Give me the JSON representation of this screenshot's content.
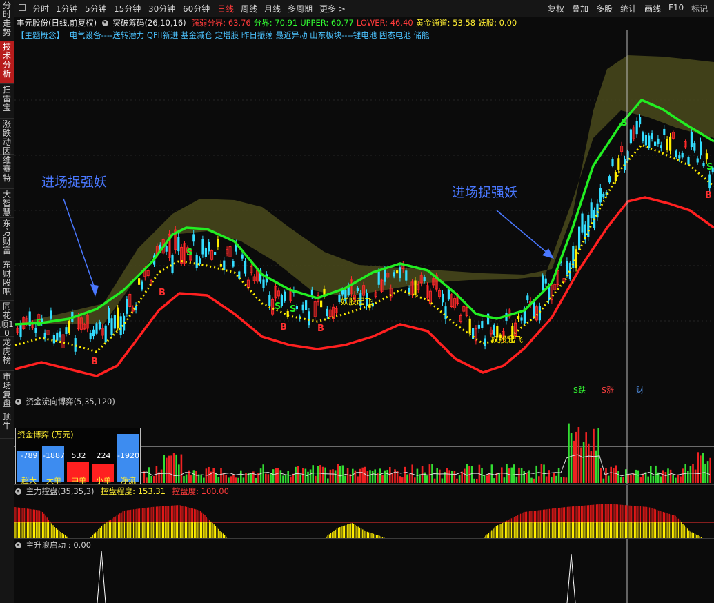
{
  "sidebar": {
    "items": [
      {
        "label": "分时走势"
      },
      {
        "label": "技术分析",
        "active": true
      },
      {
        "label": "扫雷宝"
      },
      {
        "label": "涨跌动因"
      },
      {
        "label": "维赛特"
      },
      {
        "label": "大智慧"
      },
      {
        "label": "东方财富"
      },
      {
        "label": "东财股吧"
      },
      {
        "label": "同花顺10"
      },
      {
        "label": "龙虎榜"
      },
      {
        "label": "市场复盘"
      },
      {
        "label": "顶牛"
      }
    ]
  },
  "toolbar": {
    "left_tabs": [
      "分时",
      "1分钟",
      "5分钟",
      "15分钟",
      "30分钟",
      "60分钟",
      "日线",
      "周线",
      "月线",
      "多周期",
      "更多 >"
    ],
    "active_tab": "日线",
    "right_tabs": [
      "复权",
      "叠加",
      "多股",
      "统计",
      "画线",
      "F10",
      "标记"
    ]
  },
  "info1": {
    "stock": "丰元股份(日线,前复权)",
    "indicator": "突破筹码(26,10,16)",
    "items": [
      {
        "text": "强弱分界: 63.76",
        "color": "#ff3b3b"
      },
      {
        "text": "分界: 70.91",
        "color": "#33ff33"
      },
      {
        "text": "UPPER: 60.77",
        "color": "#33ff33"
      },
      {
        "text": "LOWER: 46.40",
        "color": "#ff3b3b"
      },
      {
        "text": "黄金通道: 53.58",
        "color": "#ffee33"
      },
      {
        "text": "妖股: 0.00",
        "color": "#ffee33"
      }
    ]
  },
  "info2": {
    "tag": "【主题概念】",
    "concepts": "电气设备----送转潜力 QFII新进 基金减仓 定增股 昨日振荡 最近异动 山东板块----锂电池 固态电池 储能"
  },
  "annotations": {
    "left_text": "进场捉强妖",
    "right_text": "进场捉强妖",
    "yao_label_1": "妖股起飞",
    "yao_label_2": "妖股起飞"
  },
  "signals": {
    "buy": "B",
    "sell": "S",
    "bottom_markers": [
      "S跌",
      "S涨",
      "财"
    ]
  },
  "panel1": {
    "title": "资金流向博弈(5,35,120)",
    "legend_title": "资金博弈 (万元)",
    "bars": [
      {
        "label": "超大",
        "value": "-789",
        "color": "#3d8cf0"
      },
      {
        "label": "大单",
        "value": "-1887",
        "color": "#3d8cf0"
      },
      {
        "label": "中单",
        "value": "532",
        "color": "#ff2020"
      },
      {
        "label": "小单",
        "value": "224",
        "color": "#ff2020"
      },
      {
        "label": "净流",
        "value": "-1920",
        "color": "#3d8cf0"
      }
    ]
  },
  "panel2": {
    "title": "主力控盘(35,35,3)",
    "item1": "控盘程度: 153.31",
    "item2": "控盘度: 100.00"
  },
  "panel3": {
    "title": "主升浪启动 : 0.00"
  },
  "colors": {
    "up": "#ff2a2a",
    "down": "#33ddff",
    "yellow": "#ffee00",
    "upper_line": "#22ee22",
    "lower_line": "#ff2020",
    "cloud": "#4a4a1c"
  }
}
